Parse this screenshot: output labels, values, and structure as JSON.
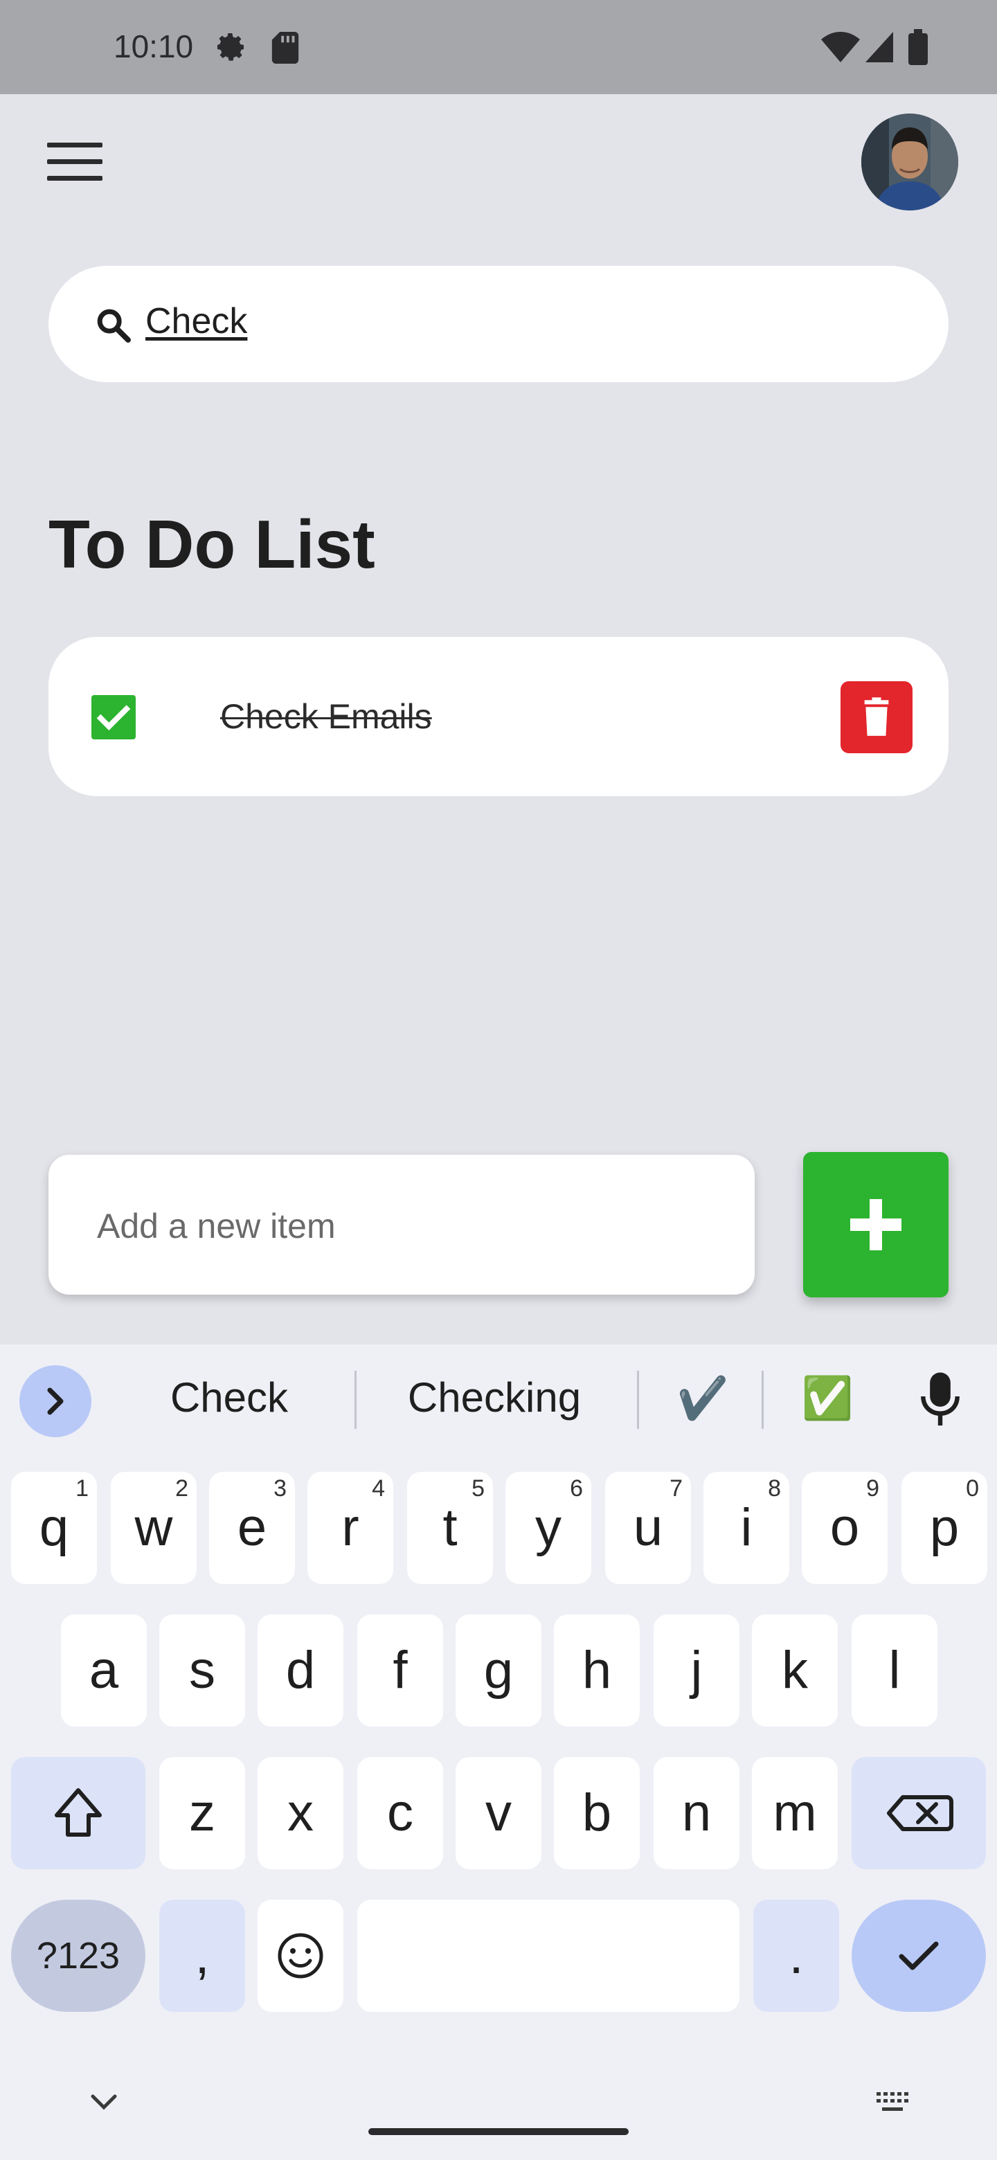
{
  "status_bar": {
    "time": "10:10",
    "icons": [
      "gear-icon",
      "sd-card-icon",
      "wifi-icon",
      "signal-icon",
      "battery-icon"
    ]
  },
  "app_bar": {
    "menu_icon": "hamburger-menu-icon",
    "avatar": "user-avatar"
  },
  "search": {
    "value": "Check",
    "icon": "search-icon"
  },
  "page": {
    "title": "To Do List"
  },
  "todos": [
    {
      "text": "Check Emails",
      "done": true
    }
  ],
  "add_item": {
    "placeholder": "Add a new item",
    "button_icon": "plus-icon"
  },
  "keyboard": {
    "suggestions": [
      "Check",
      "Checking",
      "✔️",
      "✅"
    ],
    "row1": [
      {
        "key": "q",
        "hint": "1"
      },
      {
        "key": "w",
        "hint": "2"
      },
      {
        "key": "e",
        "hint": "3"
      },
      {
        "key": "r",
        "hint": "4"
      },
      {
        "key": "t",
        "hint": "5"
      },
      {
        "key": "y",
        "hint": "6"
      },
      {
        "key": "u",
        "hint": "7"
      },
      {
        "key": "i",
        "hint": "8"
      },
      {
        "key": "o",
        "hint": "9"
      },
      {
        "key": "p",
        "hint": "0"
      }
    ],
    "row2": [
      "a",
      "s",
      "d",
      "f",
      "g",
      "h",
      "j",
      "k",
      "l"
    ],
    "row3": [
      "z",
      "x",
      "c",
      "v",
      "b",
      "n",
      "m"
    ],
    "symbols_label": "?123",
    "comma": ",",
    "period": "."
  },
  "colors": {
    "accent_green": "#2cb32f",
    "delete_red": "#e3252c",
    "background": "#e3e4ea",
    "keyboard_bg": "#eff0f6"
  }
}
